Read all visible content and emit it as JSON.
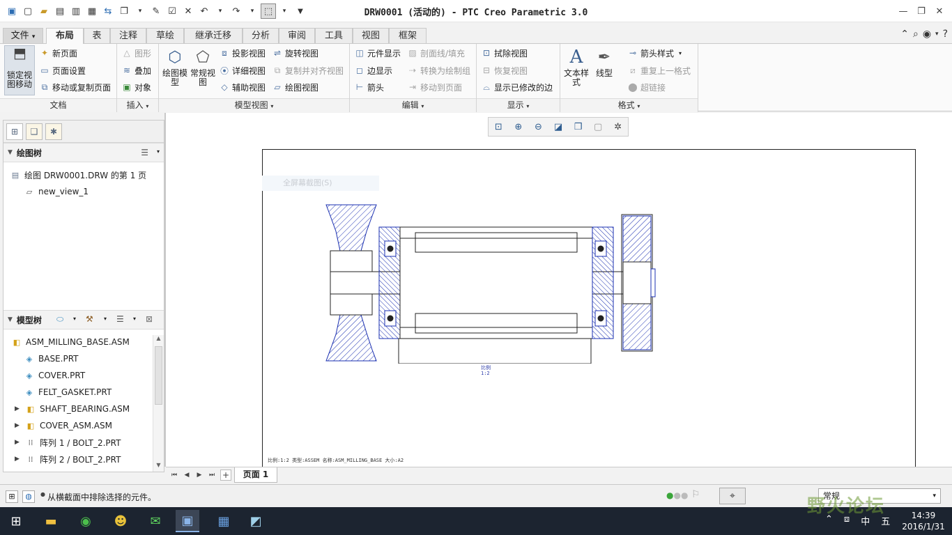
{
  "title_bar": {
    "window_title": "DRW0001 (活动的) - PTC Creo Parametric 3.0",
    "quick_access_icons": [
      "app-icon",
      "new-icon",
      "open-icon",
      "save-icon",
      "save-as-icon",
      "print-icon",
      "regenerate-icon",
      "windows-icon",
      "dropdown-icon",
      "erase-icon",
      "checkbox-icon",
      "close-window-icon",
      "undo-icon",
      "undo-dropdown-icon",
      "redo-icon",
      "redo-dropdown-icon",
      "select-box-icon",
      "dropdown-icon",
      "customize-icon"
    ]
  },
  "tabs": [
    {
      "label": "文件",
      "dropdown": "▾"
    },
    {
      "label": "布局"
    },
    {
      "label": "表"
    },
    {
      "label": "注释"
    },
    {
      "label": "草绘"
    },
    {
      "label": "继承迁移"
    },
    {
      "label": "分析"
    },
    {
      "label": "审阅"
    },
    {
      "label": "工具"
    },
    {
      "label": "视图"
    },
    {
      "label": "框架"
    }
  ],
  "ribbon": {
    "doc": {
      "lock": "锁定视图移动",
      "new_page": "新页面",
      "page_setup": "页面设置",
      "move_copy": "移动或复制页面",
      "label": "文档"
    },
    "insert": {
      "shape": "图形",
      "overlay": "叠加",
      "object": "对象",
      "label": "插入"
    },
    "model_views": {
      "drawing_model": "绘图模型",
      "general_view": "常规视图",
      "projection": "投影视图",
      "detail": "详细视图",
      "auxiliary": "辅助视图",
      "revolved": "旋转视图",
      "copy_align": "复制并对齐视图",
      "drawing_view": "绘图视图",
      "label": "模型视图"
    },
    "edit": {
      "element_display": "元件显示",
      "edge_display": "边显示",
      "arrow": "箭头",
      "hatching": "剖面线/填充",
      "convert": "转换为绘制组",
      "move_to_page": "移动到页面",
      "label": "编辑"
    },
    "display": {
      "erase_view": "拭除视图",
      "resume_view": "恢复视图",
      "show_modified": "显示已修改的边",
      "label": "显示"
    },
    "format": {
      "text_style": "文本样式",
      "line_style": "线型",
      "arrow_style": "箭头样式",
      "repeat_format": "重复上一格式",
      "hyperlink": "超链接",
      "label": "格式"
    }
  },
  "left_panel": {
    "drawing_tree": {
      "title": "绘图树",
      "items": [
        {
          "label": "绘图 DRW0001.DRW 的第 1 页"
        },
        {
          "label": "new_view_1"
        }
      ]
    },
    "model_tree": {
      "title": "模型树",
      "items": [
        {
          "label": "ASM_MILLING_BASE.ASM",
          "expandable": false
        },
        {
          "label": "BASE.PRT",
          "expandable": false
        },
        {
          "label": "COVER.PRT",
          "expandable": false
        },
        {
          "label": "FELT_GASKET.PRT",
          "expandable": false
        },
        {
          "label": "SHAFT_BEARING.ASM",
          "expandable": true
        },
        {
          "label": "COVER_ASM.ASM",
          "expandable": true
        },
        {
          "label": "阵列 1 / BOLT_2.PRT",
          "expandable": true
        },
        {
          "label": "阵列 2 / BOLT_2.PRT",
          "expandable": true
        }
      ]
    }
  },
  "canvas": {
    "ghost_menu_item": "全屏幕截图(S)",
    "sheet_info": "比例:1:2    类型:ASSEM    名称:ASM_MILLING_BASE    大小:A2",
    "view_scale_label": [
      "比例",
      "1:2"
    ]
  },
  "page_bar": {
    "add": "+",
    "page_tab": "页面 1"
  },
  "status_bar": {
    "message": "从横截面中排除选择的元件。",
    "selection_filter": "常规"
  },
  "taskbar": {
    "time": "14:39",
    "date": "2016/1/31",
    "ime": "中",
    "ime2": "五"
  },
  "watermark": "野火论坛",
  "colors": {
    "drawing_line": "#1a2fb0",
    "hatch": "#1a2fb0",
    "ribbon_bg": "#fafafa",
    "taskbar_bg": "#1c2430"
  }
}
